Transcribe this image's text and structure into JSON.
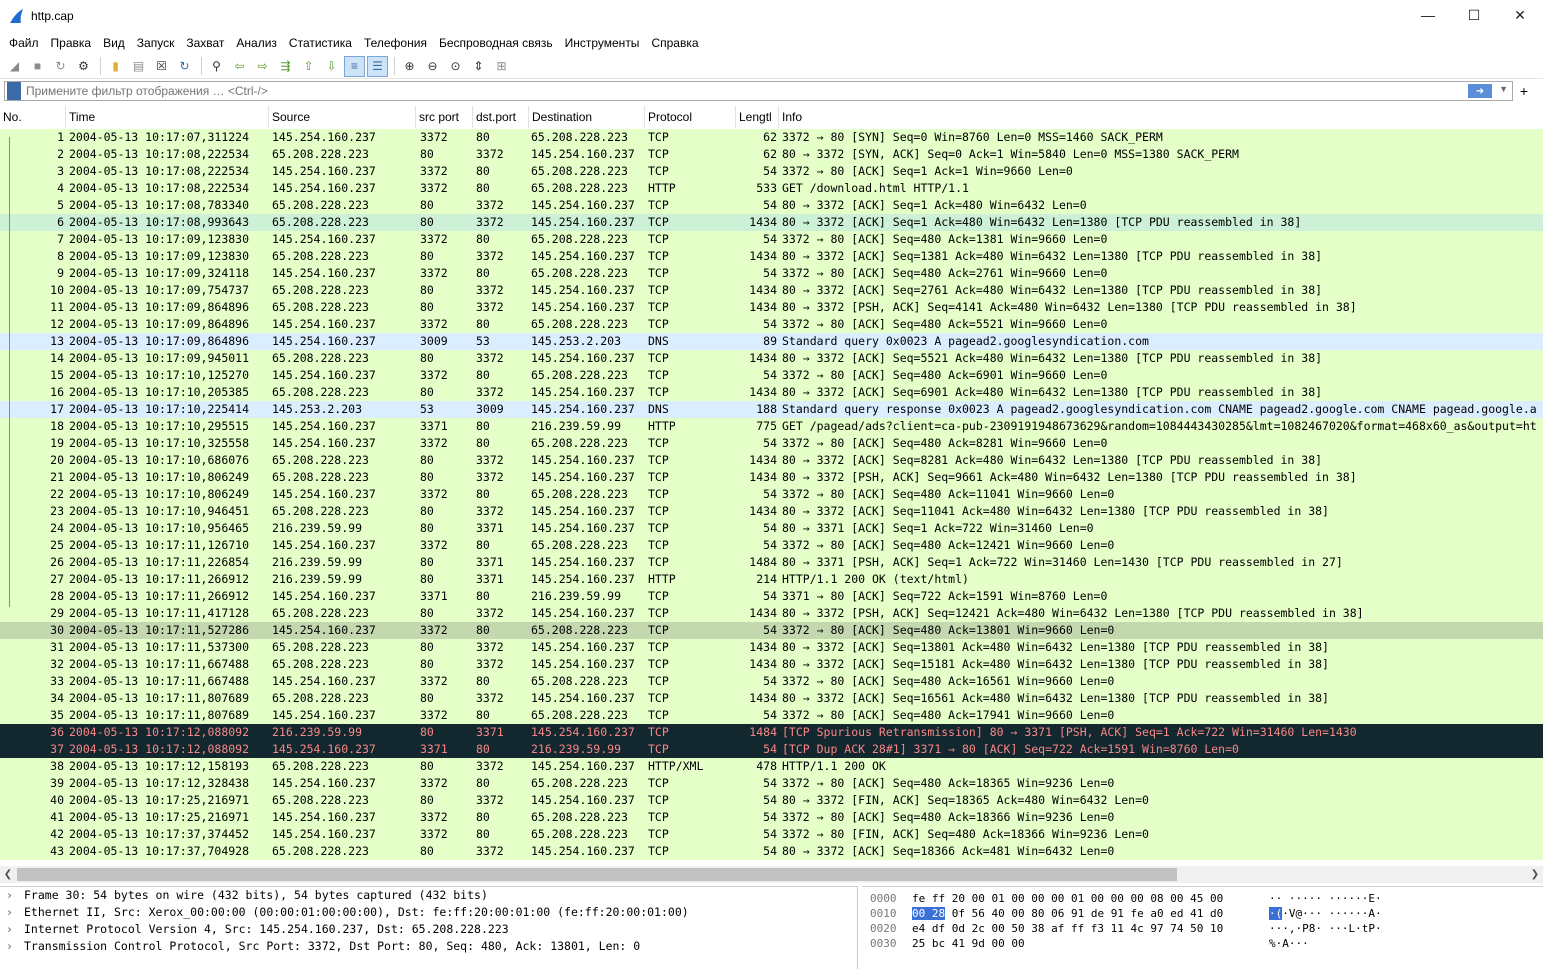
{
  "window": {
    "title": "http.cap",
    "minimize_icon": "minimize-icon",
    "maximize_icon": "maximize-icon",
    "close_icon": "close-icon"
  },
  "menu": [
    "Файл",
    "Правка",
    "Вид",
    "Запуск",
    "Захват",
    "Анализ",
    "Статистика",
    "Телефония",
    "Беспроводная связь",
    "Инструменты",
    "Справка"
  ],
  "filter": {
    "placeholder": "Примените фильтр отображения … <Ctrl-/>",
    "apply_icon": "arrow-right-icon",
    "add_label": "+"
  },
  "columns": {
    "no": "No.",
    "time": "Time",
    "source": "Source",
    "src_port": "src port",
    "dst_port": "dst.port",
    "destination": "Destination",
    "protocol": "Protocol",
    "length": "Lengtl",
    "info": "Info"
  },
  "packets": [
    [
      "1",
      "2004-05-13 10:17:07,311224",
      "145.254.160.237",
      "3372",
      "80",
      "65.208.228.223",
      "TCP",
      "62",
      "3372 → 80 [SYN] Seq=0 Win=8760 Len=0 MSS=1460 SACK_PERM",
      "tcp"
    ],
    [
      "2",
      "2004-05-13 10:17:08,222534",
      "65.208.228.223",
      "80",
      "3372",
      "145.254.160.237",
      "TCP",
      "62",
      "80 → 3372 [SYN, ACK] Seq=0 Ack=1 Win=5840 Len=0 MSS=1380 SACK_PERM",
      "tcp"
    ],
    [
      "3",
      "2004-05-13 10:17:08,222534",
      "145.254.160.237",
      "3372",
      "80",
      "65.208.228.223",
      "TCP",
      "54",
      "3372 → 80 [ACK] Seq=1 Ack=1 Win=9660 Len=0",
      "tcp"
    ],
    [
      "4",
      "2004-05-13 10:17:08,222534",
      "145.254.160.237",
      "3372",
      "80",
      "65.208.228.223",
      "HTTP",
      "533",
      "GET /download.html HTTP/1.1",
      "tcp"
    ],
    [
      "5",
      "2004-05-13 10:17:08,783340",
      "65.208.228.223",
      "80",
      "3372",
      "145.254.160.237",
      "TCP",
      "54",
      "80 → 3372 [ACK] Seq=1 Ack=480 Win=6432 Len=0",
      "tcp"
    ],
    [
      "6",
      "2004-05-13 10:17:08,993643",
      "65.208.228.223",
      "80",
      "3372",
      "145.254.160.237",
      "TCP",
      "1434",
      "80 → 3372 [ACK] Seq=1 Ack=480 Win=6432 Len=1380 [TCP PDU reassembled in 38]",
      "hl"
    ],
    [
      "7",
      "2004-05-13 10:17:09,123830",
      "145.254.160.237",
      "3372",
      "80",
      "65.208.228.223",
      "TCP",
      "54",
      "3372 → 80 [ACK] Seq=480 Ack=1381 Win=9660 Len=0",
      "tcp"
    ],
    [
      "8",
      "2004-05-13 10:17:09,123830",
      "65.208.228.223",
      "80",
      "3372",
      "145.254.160.237",
      "TCP",
      "1434",
      "80 → 3372 [ACK] Seq=1381 Ack=480 Win=6432 Len=1380 [TCP PDU reassembled in 38]",
      "tcp"
    ],
    [
      "9",
      "2004-05-13 10:17:09,324118",
      "145.254.160.237",
      "3372",
      "80",
      "65.208.228.223",
      "TCP",
      "54",
      "3372 → 80 [ACK] Seq=480 Ack=2761 Win=9660 Len=0",
      "tcp"
    ],
    [
      "10",
      "2004-05-13 10:17:09,754737",
      "65.208.228.223",
      "80",
      "3372",
      "145.254.160.237",
      "TCP",
      "1434",
      "80 → 3372 [ACK] Seq=2761 Ack=480 Win=6432 Len=1380 [TCP PDU reassembled in 38]",
      "tcp"
    ],
    [
      "11",
      "2004-05-13 10:17:09,864896",
      "65.208.228.223",
      "80",
      "3372",
      "145.254.160.237",
      "TCP",
      "1434",
      "80 → 3372 [PSH, ACK] Seq=4141 Ack=480 Win=6432 Len=1380 [TCP PDU reassembled in 38]",
      "tcp"
    ],
    [
      "12",
      "2004-05-13 10:17:09,864896",
      "145.254.160.237",
      "3372",
      "80",
      "65.208.228.223",
      "TCP",
      "54",
      "3372 → 80 [ACK] Seq=480 Ack=5521 Win=9660 Len=0",
      "tcp"
    ],
    [
      "13",
      "2004-05-13 10:17:09,864896",
      "145.254.160.237",
      "3009",
      "53",
      "145.253.2.203",
      "DNS",
      "89",
      "Standard query 0x0023 A pagead2.googlesyndication.com",
      "dns"
    ],
    [
      "14",
      "2004-05-13 10:17:09,945011",
      "65.208.228.223",
      "80",
      "3372",
      "145.254.160.237",
      "TCP",
      "1434",
      "80 → 3372 [ACK] Seq=5521 Ack=480 Win=6432 Len=1380 [TCP PDU reassembled in 38]",
      "tcp"
    ],
    [
      "15",
      "2004-05-13 10:17:10,125270",
      "145.254.160.237",
      "3372",
      "80",
      "65.208.228.223",
      "TCP",
      "54",
      "3372 → 80 [ACK] Seq=480 Ack=6901 Win=9660 Len=0",
      "tcp"
    ],
    [
      "16",
      "2004-05-13 10:17:10,205385",
      "65.208.228.223",
      "80",
      "3372",
      "145.254.160.237",
      "TCP",
      "1434",
      "80 → 3372 [ACK] Seq=6901 Ack=480 Win=6432 Len=1380 [TCP PDU reassembled in 38]",
      "tcp"
    ],
    [
      "17",
      "2004-05-13 10:17:10,225414",
      "145.253.2.203",
      "53",
      "3009",
      "145.254.160.237",
      "DNS",
      "188",
      "Standard query response 0x0023 A pagead2.googlesyndication.com CNAME pagead2.google.com CNAME pagead.google.a",
      "dns"
    ],
    [
      "18",
      "2004-05-13 10:17:10,295515",
      "145.254.160.237",
      "3371",
      "80",
      "216.239.59.99",
      "HTTP",
      "775",
      "GET /pagead/ads?client=ca-pub-2309191948673629&random=1084443430285&lmt=1082467020&format=468x60_as&output=ht",
      "tcp"
    ],
    [
      "19",
      "2004-05-13 10:17:10,325558",
      "145.254.160.237",
      "3372",
      "80",
      "65.208.228.223",
      "TCP",
      "54",
      "3372 → 80 [ACK] Seq=480 Ack=8281 Win=9660 Len=0",
      "tcp"
    ],
    [
      "20",
      "2004-05-13 10:17:10,686076",
      "65.208.228.223",
      "80",
      "3372",
      "145.254.160.237",
      "TCP",
      "1434",
      "80 → 3372 [ACK] Seq=8281 Ack=480 Win=6432 Len=1380 [TCP PDU reassembled in 38]",
      "tcp"
    ],
    [
      "21",
      "2004-05-13 10:17:10,806249",
      "65.208.228.223",
      "80",
      "3372",
      "145.254.160.237",
      "TCP",
      "1434",
      "80 → 3372 [PSH, ACK] Seq=9661 Ack=480 Win=6432 Len=1380 [TCP PDU reassembled in 38]",
      "tcp"
    ],
    [
      "22",
      "2004-05-13 10:17:10,806249",
      "145.254.160.237",
      "3372",
      "80",
      "65.208.228.223",
      "TCP",
      "54",
      "3372 → 80 [ACK] Seq=480 Ack=11041 Win=9660 Len=0",
      "tcp"
    ],
    [
      "23",
      "2004-05-13 10:17:10,946451",
      "65.208.228.223",
      "80",
      "3372",
      "145.254.160.237",
      "TCP",
      "1434",
      "80 → 3372 [ACK] Seq=11041 Ack=480 Win=6432 Len=1380 [TCP PDU reassembled in 38]",
      "tcp"
    ],
    [
      "24",
      "2004-05-13 10:17:10,956465",
      "216.239.59.99",
      "80",
      "3371",
      "145.254.160.237",
      "TCP",
      "54",
      "80 → 3371 [ACK] Seq=1 Ack=722 Win=31460 Len=0",
      "tcp"
    ],
    [
      "25",
      "2004-05-13 10:17:11,126710",
      "145.254.160.237",
      "3372",
      "80",
      "65.208.228.223",
      "TCP",
      "54",
      "3372 → 80 [ACK] Seq=480 Ack=12421 Win=9660 Len=0",
      "tcp"
    ],
    [
      "26",
      "2004-05-13 10:17:11,226854",
      "216.239.59.99",
      "80",
      "3371",
      "145.254.160.237",
      "TCP",
      "1484",
      "80 → 3371 [PSH, ACK] Seq=1 Ack=722 Win=31460 Len=1430 [TCP PDU reassembled in 27]",
      "tcp"
    ],
    [
      "27",
      "2004-05-13 10:17:11,266912",
      "216.239.59.99",
      "80",
      "3371",
      "145.254.160.237",
      "HTTP",
      "214",
      "HTTP/1.1 200 OK  (text/html)",
      "tcp"
    ],
    [
      "28",
      "2004-05-13 10:17:11,266912",
      "145.254.160.237",
      "3371",
      "80",
      "216.239.59.99",
      "TCP",
      "54",
      "3371 → 80 [ACK] Seq=722 Ack=1591 Win=8760 Len=0",
      "tcp"
    ],
    [
      "29",
      "2004-05-13 10:17:11,417128",
      "65.208.228.223",
      "80",
      "3372",
      "145.254.160.237",
      "TCP",
      "1434",
      "80 → 3372 [PSH, ACK] Seq=12421 Ack=480 Win=6432 Len=1380 [TCP PDU reassembled in 38]",
      "tcp"
    ],
    [
      "30",
      "2004-05-13 10:17:11,527286",
      "145.254.160.237",
      "3372",
      "80",
      "65.208.228.223",
      "TCP",
      "54",
      "3372 → 80 [ACK] Seq=480 Ack=13801 Win=9660 Len=0",
      "sel"
    ],
    [
      "31",
      "2004-05-13 10:17:11,537300",
      "65.208.228.223",
      "80",
      "3372",
      "145.254.160.237",
      "TCP",
      "1434",
      "80 → 3372 [ACK] Seq=13801 Ack=480 Win=6432 Len=1380 [TCP PDU reassembled in 38]",
      "tcp"
    ],
    [
      "32",
      "2004-05-13 10:17:11,667488",
      "65.208.228.223",
      "80",
      "3372",
      "145.254.160.237",
      "TCP",
      "1434",
      "80 → 3372 [ACK] Seq=15181 Ack=480 Win=6432 Len=1380 [TCP PDU reassembled in 38]",
      "tcp"
    ],
    [
      "33",
      "2004-05-13 10:17:11,667488",
      "145.254.160.237",
      "3372",
      "80",
      "65.208.228.223",
      "TCP",
      "54",
      "3372 → 80 [ACK] Seq=480 Ack=16561 Win=9660 Len=0",
      "tcp"
    ],
    [
      "34",
      "2004-05-13 10:17:11,807689",
      "65.208.228.223",
      "80",
      "3372",
      "145.254.160.237",
      "TCP",
      "1434",
      "80 → 3372 [ACK] Seq=16561 Ack=480 Win=6432 Len=1380 [TCP PDU reassembled in 38]",
      "tcp"
    ],
    [
      "35",
      "2004-05-13 10:17:11,807689",
      "145.254.160.237",
      "3372",
      "80",
      "65.208.228.223",
      "TCP",
      "54",
      "3372 → 80 [ACK] Seq=480 Ack=17941 Win=9660 Len=0",
      "tcp"
    ],
    [
      "36",
      "2004-05-13 10:17:12,088092",
      "216.239.59.99",
      "80",
      "3371",
      "145.254.160.237",
      "TCP",
      "1484",
      "[TCP Spurious Retransmission] 80 → 3371 [PSH, ACK] Seq=1 Ack=722 Win=31460 Len=1430",
      "bad"
    ],
    [
      "37",
      "2004-05-13 10:17:12,088092",
      "145.254.160.237",
      "3371",
      "80",
      "216.239.59.99",
      "TCP",
      "54",
      "[TCP Dup ACK 28#1] 3371 → 80 [ACK] Seq=722 Ack=1591 Win=8760 Len=0",
      "bad"
    ],
    [
      "38",
      "2004-05-13 10:17:12,158193",
      "65.208.228.223",
      "80",
      "3372",
      "145.254.160.237",
      "HTTP/XML",
      "478",
      "HTTP/1.1 200 OK",
      "tcp"
    ],
    [
      "39",
      "2004-05-13 10:17:12,328438",
      "145.254.160.237",
      "3372",
      "80",
      "65.208.228.223",
      "TCP",
      "54",
      "3372 → 80 [ACK] Seq=480 Ack=18365 Win=9236 Len=0",
      "tcp"
    ],
    [
      "40",
      "2004-05-13 10:17:25,216971",
      "65.208.228.223",
      "80",
      "3372",
      "145.254.160.237",
      "TCP",
      "54",
      "80 → 3372 [FIN, ACK] Seq=18365 Ack=480 Win=6432 Len=0",
      "tcp"
    ],
    [
      "41",
      "2004-05-13 10:17:25,216971",
      "145.254.160.237",
      "3372",
      "80",
      "65.208.228.223",
      "TCP",
      "54",
      "3372 → 80 [ACK] Seq=480 Ack=18366 Win=9236 Len=0",
      "tcp"
    ],
    [
      "42",
      "2004-05-13 10:17:37,374452",
      "145.254.160.237",
      "3372",
      "80",
      "65.208.228.223",
      "TCP",
      "54",
      "3372 → 80 [FIN, ACK] Seq=480 Ack=18366 Win=9236 Len=0",
      "tcp"
    ],
    [
      "43",
      "2004-05-13 10:17:37,704928",
      "65.208.228.223",
      "80",
      "3372",
      "145.254.160.237",
      "TCP",
      "54",
      "80 → 3372 [ACK] Seq=18366 Ack=481 Win=6432 Len=0",
      "tcp"
    ]
  ],
  "details": [
    "Frame 30: 54 bytes on wire (432 bits), 54 bytes captured (432 bits)",
    "Ethernet II, Src: Xerox_00:00:00 (00:00:01:00:00:00), Dst: fe:ff:20:00:01:00 (fe:ff:20:00:01:00)",
    "Internet Protocol Version 4, Src: 145.254.160.237, Dst: 65.208.228.223",
    "Transmission Control Protocol, Src Port: 3372, Dst Port: 80, Seq: 480, Ack: 13801, Len: 0"
  ],
  "bytes": [
    {
      "offset": "0000",
      "hex_a": "",
      "hex_sel": "",
      "hex_b": "fe ff 20 00 01 00 00 00  01 00 00 00 08 00 45 00",
      "ascii_a": "",
      "ascii_sel": "",
      "ascii_b": "·· ·····  ······E·"
    },
    {
      "offset": "0010",
      "hex_a": "",
      "hex_sel": "00 28",
      "hex_b": " 0f 56 40 00 80 06  91 de 91 fe a0 ed 41 d0",
      "ascii_a": "",
      "ascii_sel": "·(",
      "ascii_b": "·V@···  ······A·"
    },
    {
      "offset": "0020",
      "hex_a": "",
      "hex_sel": "",
      "hex_b": "e4 df 0d 2c 00 50 38 af  ff f3 11 4c 97 74 50 10",
      "ascii_a": "",
      "ascii_sel": "",
      "ascii_b": "···,·P8·  ···L·tP·"
    },
    {
      "offset": "0030",
      "hex_a": "",
      "hex_sel": "",
      "hex_b": "25 bc 41 9d 00 00",
      "ascii_a": "",
      "ascii_sel": "",
      "ascii_b": "%·A···"
    }
  ]
}
